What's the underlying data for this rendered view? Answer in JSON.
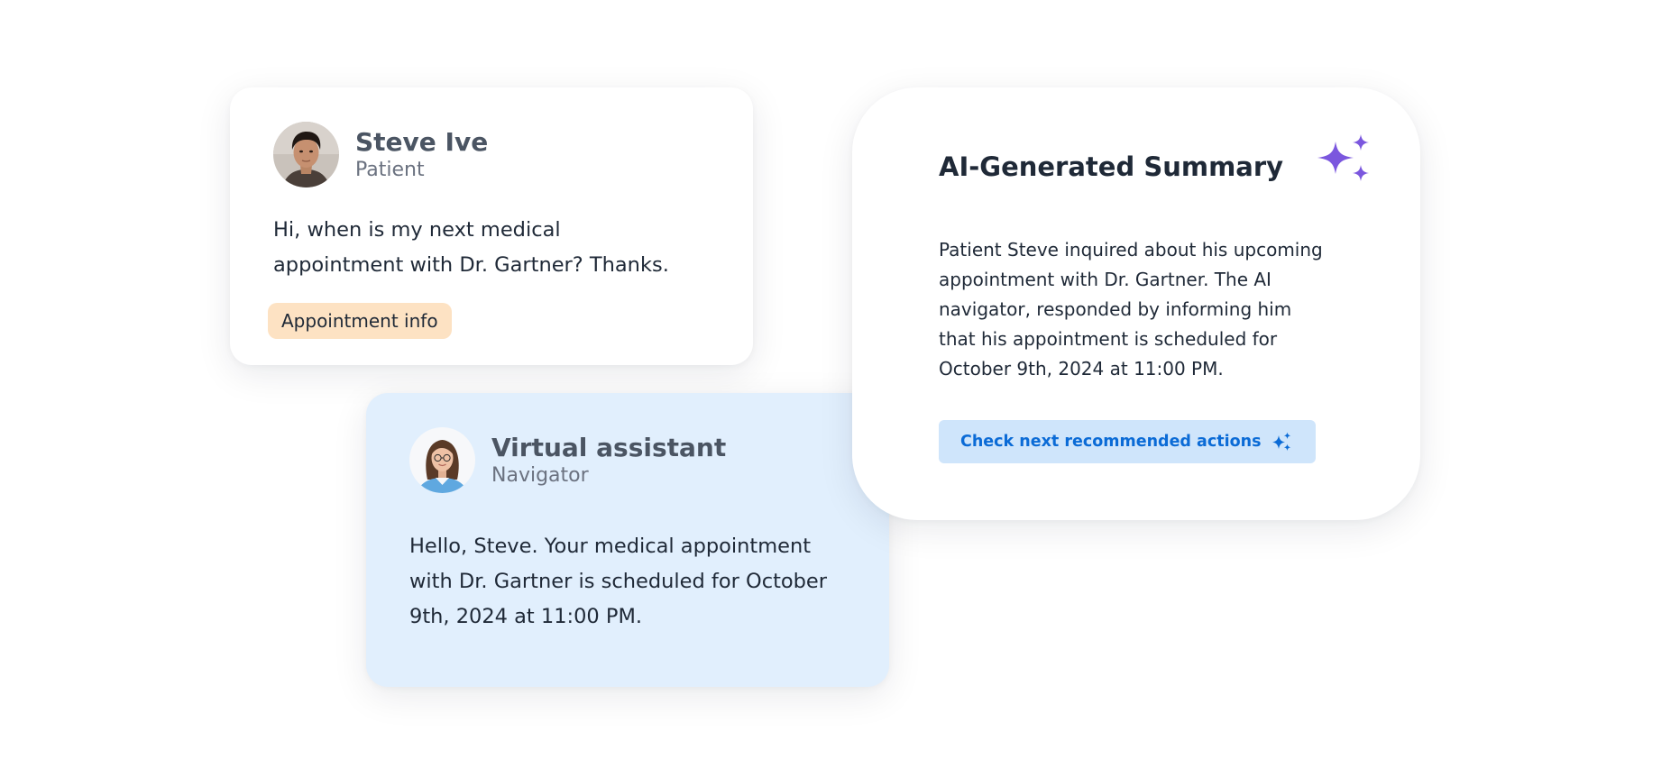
{
  "patient": {
    "name": "Steve Ive",
    "role": "Patient",
    "message": "Hi, when is my next medical appointment with Dr. Gartner? Thanks.",
    "tag": "Appointment info"
  },
  "assistant": {
    "name": "Virtual assistant",
    "role": "Navigator",
    "message": "Hello, Steve. Your medical appointment with Dr. Gartner is scheduled for October 9th, 2024 at 11:00 PM."
  },
  "summary": {
    "title": "AI-Generated Summary",
    "text": "Patient Steve inquired about his upcoming appointment with Dr. Gartner. The AI navigator, responded by informing him that his appointment is scheduled for October 9th, 2024 at 11:00 PM.",
    "cta_label": "Check next recommended actions"
  },
  "icons": {
    "summary_icon": "sparkles-icon",
    "cta_icon": "sparkles-icon"
  },
  "colors": {
    "accent_purple": "#7b57de",
    "cta_blue": "#0b6bd6",
    "cta_bg": "#cfe5fb",
    "assistant_bg": "#e1effd",
    "tag_bg": "#fde2c3"
  }
}
